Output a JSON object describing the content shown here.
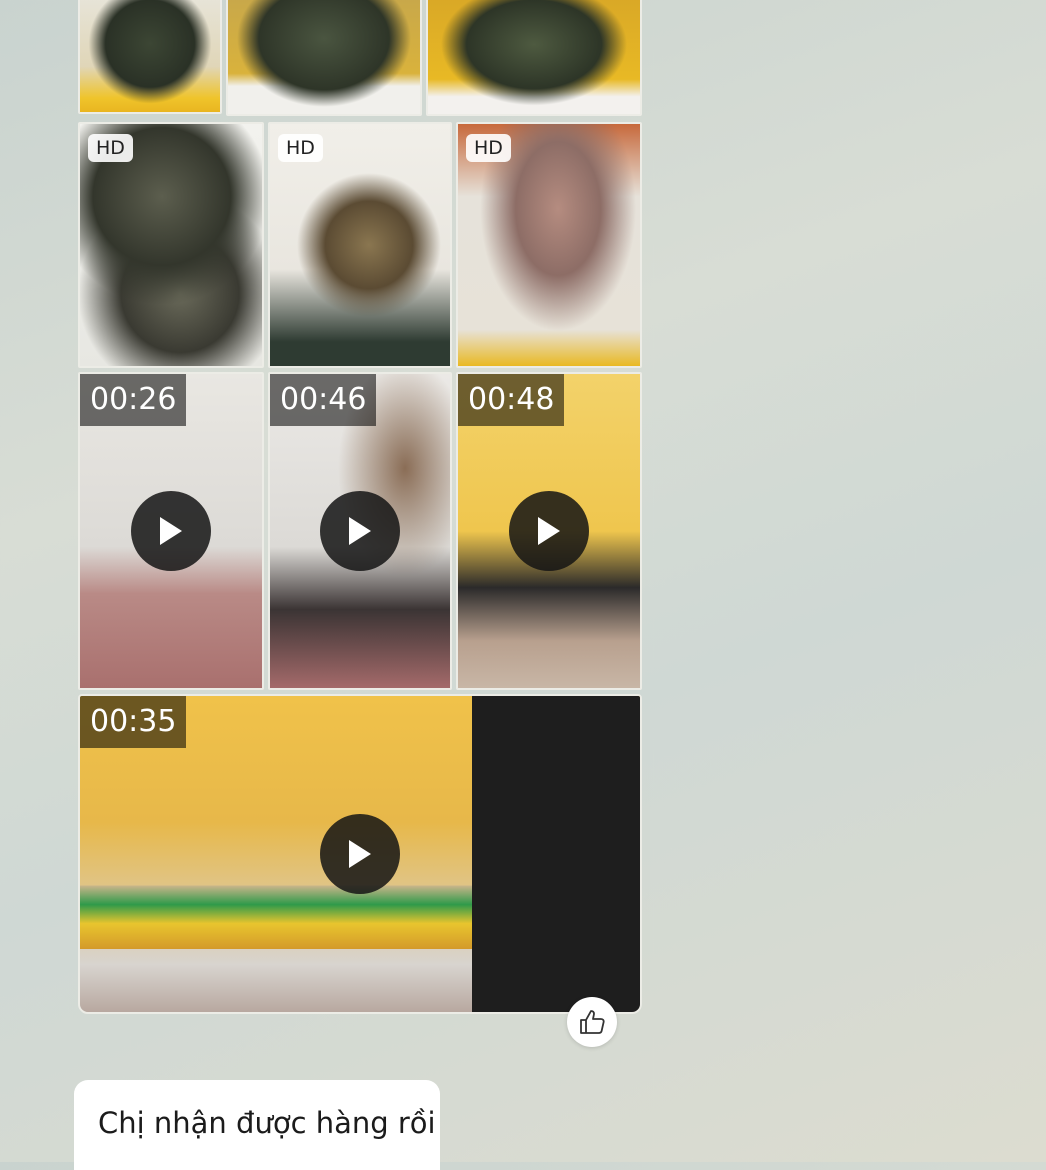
{
  "images": {
    "row1": [
      {
        "alt": "lobster-in-hand"
      },
      {
        "alt": "lobsters-on-box"
      },
      {
        "alt": "lobsters-on-yellow-box"
      }
    ],
    "row2": [
      {
        "badge": "HD",
        "alt": "crabs-in-foam-box"
      },
      {
        "badge": "HD",
        "alt": "crab-in-hand"
      },
      {
        "badge": "HD",
        "alt": "frozen-seafood-packs"
      }
    ]
  },
  "videos": {
    "row3": [
      {
        "duration": "00:26"
      },
      {
        "duration": "00:46"
      },
      {
        "duration": "00:48"
      }
    ],
    "wide": {
      "duration": "00:35"
    }
  },
  "message": {
    "text": "Chị nhận được hàng rồi"
  },
  "icons": {
    "play": "play-icon",
    "reaction": "thumbs-up-icon"
  },
  "colors": {
    "bubble": "#ffffff",
    "badge_bg": "#ffffff",
    "duration_bg": "#000000"
  }
}
